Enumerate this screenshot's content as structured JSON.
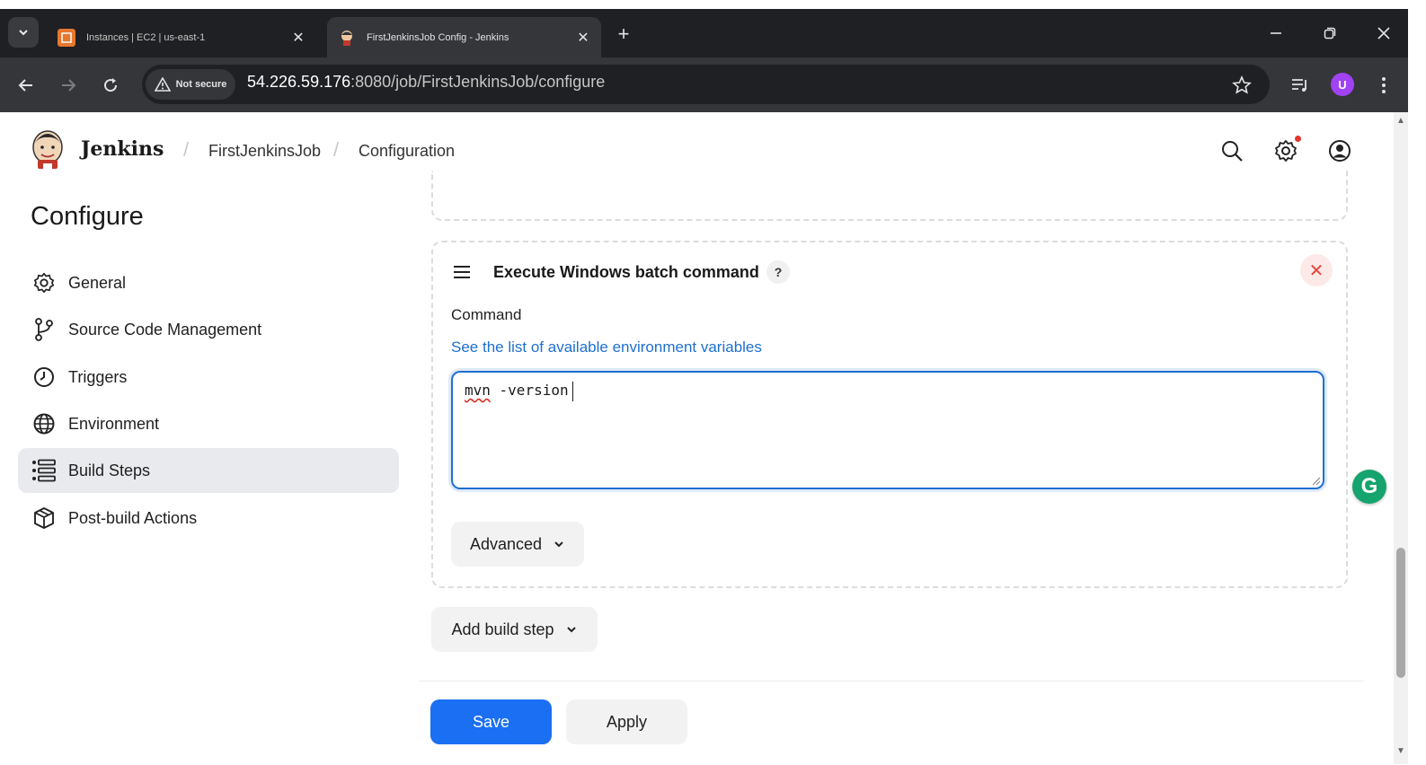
{
  "browser": {
    "tabs": [
      {
        "title": "Instances | EC2 | us-east-1",
        "active": false,
        "favicon": "aws-ec2-icon"
      },
      {
        "title": "FirstJenkinsJob Config - Jenkins",
        "active": true,
        "favicon": "jenkins-icon"
      }
    ],
    "security_label": "Not secure",
    "url_host": "54.226.59.176",
    "url_path": ":8080/job/FirstJenkinsJob/configure",
    "profile_initial": "U",
    "colors": {
      "tabbar": "#1f2023",
      "toolbar": "#35363a",
      "profile": "#a142f4"
    }
  },
  "header": {
    "brand": "Jenkins",
    "breadcrumbs": [
      "FirstJenkinsJob",
      "Configuration"
    ],
    "icons": [
      "search-icon",
      "settings-icon",
      "account-icon"
    ]
  },
  "sidebar": {
    "title": "Configure",
    "items": [
      {
        "label": "General",
        "icon": "gear-icon",
        "active": false
      },
      {
        "label": "Source Code Management",
        "icon": "branch-icon",
        "active": false
      },
      {
        "label": "Triggers",
        "icon": "clock-icon",
        "active": false
      },
      {
        "label": "Environment",
        "icon": "globe-icon",
        "active": false
      },
      {
        "label": "Build Steps",
        "icon": "list-icon",
        "active": true
      },
      {
        "label": "Post-build Actions",
        "icon": "package-icon",
        "active": false
      }
    ]
  },
  "build_step": {
    "title": "Execute Windows batch command",
    "help": "?",
    "delete": "✕",
    "command_label": "Command",
    "env_prefix": "See ",
    "env_link": "the list of available environment variables",
    "command_word": "mvn",
    "command_rest": " -version",
    "advanced_label": "Advanced"
  },
  "actions": {
    "add_build_step": "Add build step",
    "save": "Save",
    "apply": "Apply"
  },
  "extensions": {
    "grammarly": "G"
  },
  "colors": {
    "primary": "#1b6ff2",
    "link": "#1f6fd0",
    "delete": "#e5483d",
    "grammarly": "#15a36e"
  }
}
